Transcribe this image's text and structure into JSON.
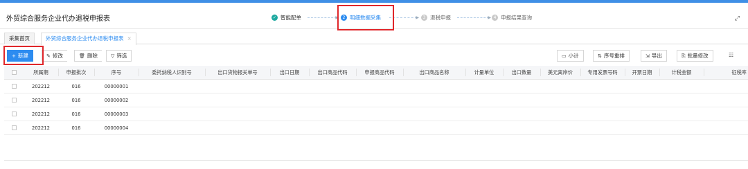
{
  "app": {
    "title": "外贸综合服务企业代办退税申报表"
  },
  "steps": [
    {
      "label": "智能配单",
      "status": "done",
      "mark": "✓"
    },
    {
      "label": "明细数据采集",
      "status": "active",
      "mark": "2"
    },
    {
      "label": "退税申报",
      "status": "pending",
      "mark": "3"
    },
    {
      "label": "申报结果查询",
      "status": "pending",
      "mark": "4"
    }
  ],
  "tabs": [
    {
      "label": "采集首页",
      "active": false
    },
    {
      "label": "外贸综合服务企业代办退税申报表",
      "active": true,
      "close": "×"
    }
  ],
  "toolbar": {
    "new_label": "新建",
    "new_icon": "+",
    "edit_label": "修改",
    "delete_label": "删除",
    "filter_label": "筛选",
    "subtotal_label": "小计",
    "reorder_label": "序号重排",
    "export_label": "导出",
    "batch_edit_label": "批量修改"
  },
  "table": {
    "columns": [
      "所属期",
      "申报批次",
      "序号",
      "委托纳税人识别号",
      "出口货物报关单号",
      "出口日期",
      "出口商品代码",
      "申报商品代码",
      "出口商品名称",
      "计量单位",
      "出口数量",
      "美元离岸价",
      "专用发票号码",
      "开票日期",
      "计税金额",
      "征税率"
    ],
    "rows": [
      [
        "202212",
        "016",
        "00000001"
      ],
      [
        "202212",
        "016",
        "00000002"
      ],
      [
        "202212",
        "016",
        "00000003"
      ],
      [
        "202212",
        "016",
        "00000004"
      ]
    ]
  }
}
